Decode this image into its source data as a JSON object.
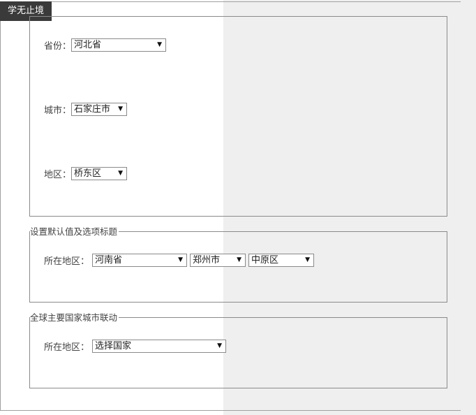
{
  "header": {
    "title": "学无止境"
  },
  "section1": {
    "province_label": "省份：",
    "province_value": "河北省",
    "city_label": "城市：",
    "city_value": "石家庄市",
    "district_label": "地区：",
    "district_value": "桥东区"
  },
  "section2": {
    "legend": "设置默认值及选项标题",
    "label": "所在地区：",
    "province_value": "河南省",
    "city_value": "郑州市",
    "district_value": "中原区"
  },
  "section3": {
    "legend": "全球主要国家城市联动",
    "label": "所在地区：",
    "country_value": "选择国家"
  }
}
